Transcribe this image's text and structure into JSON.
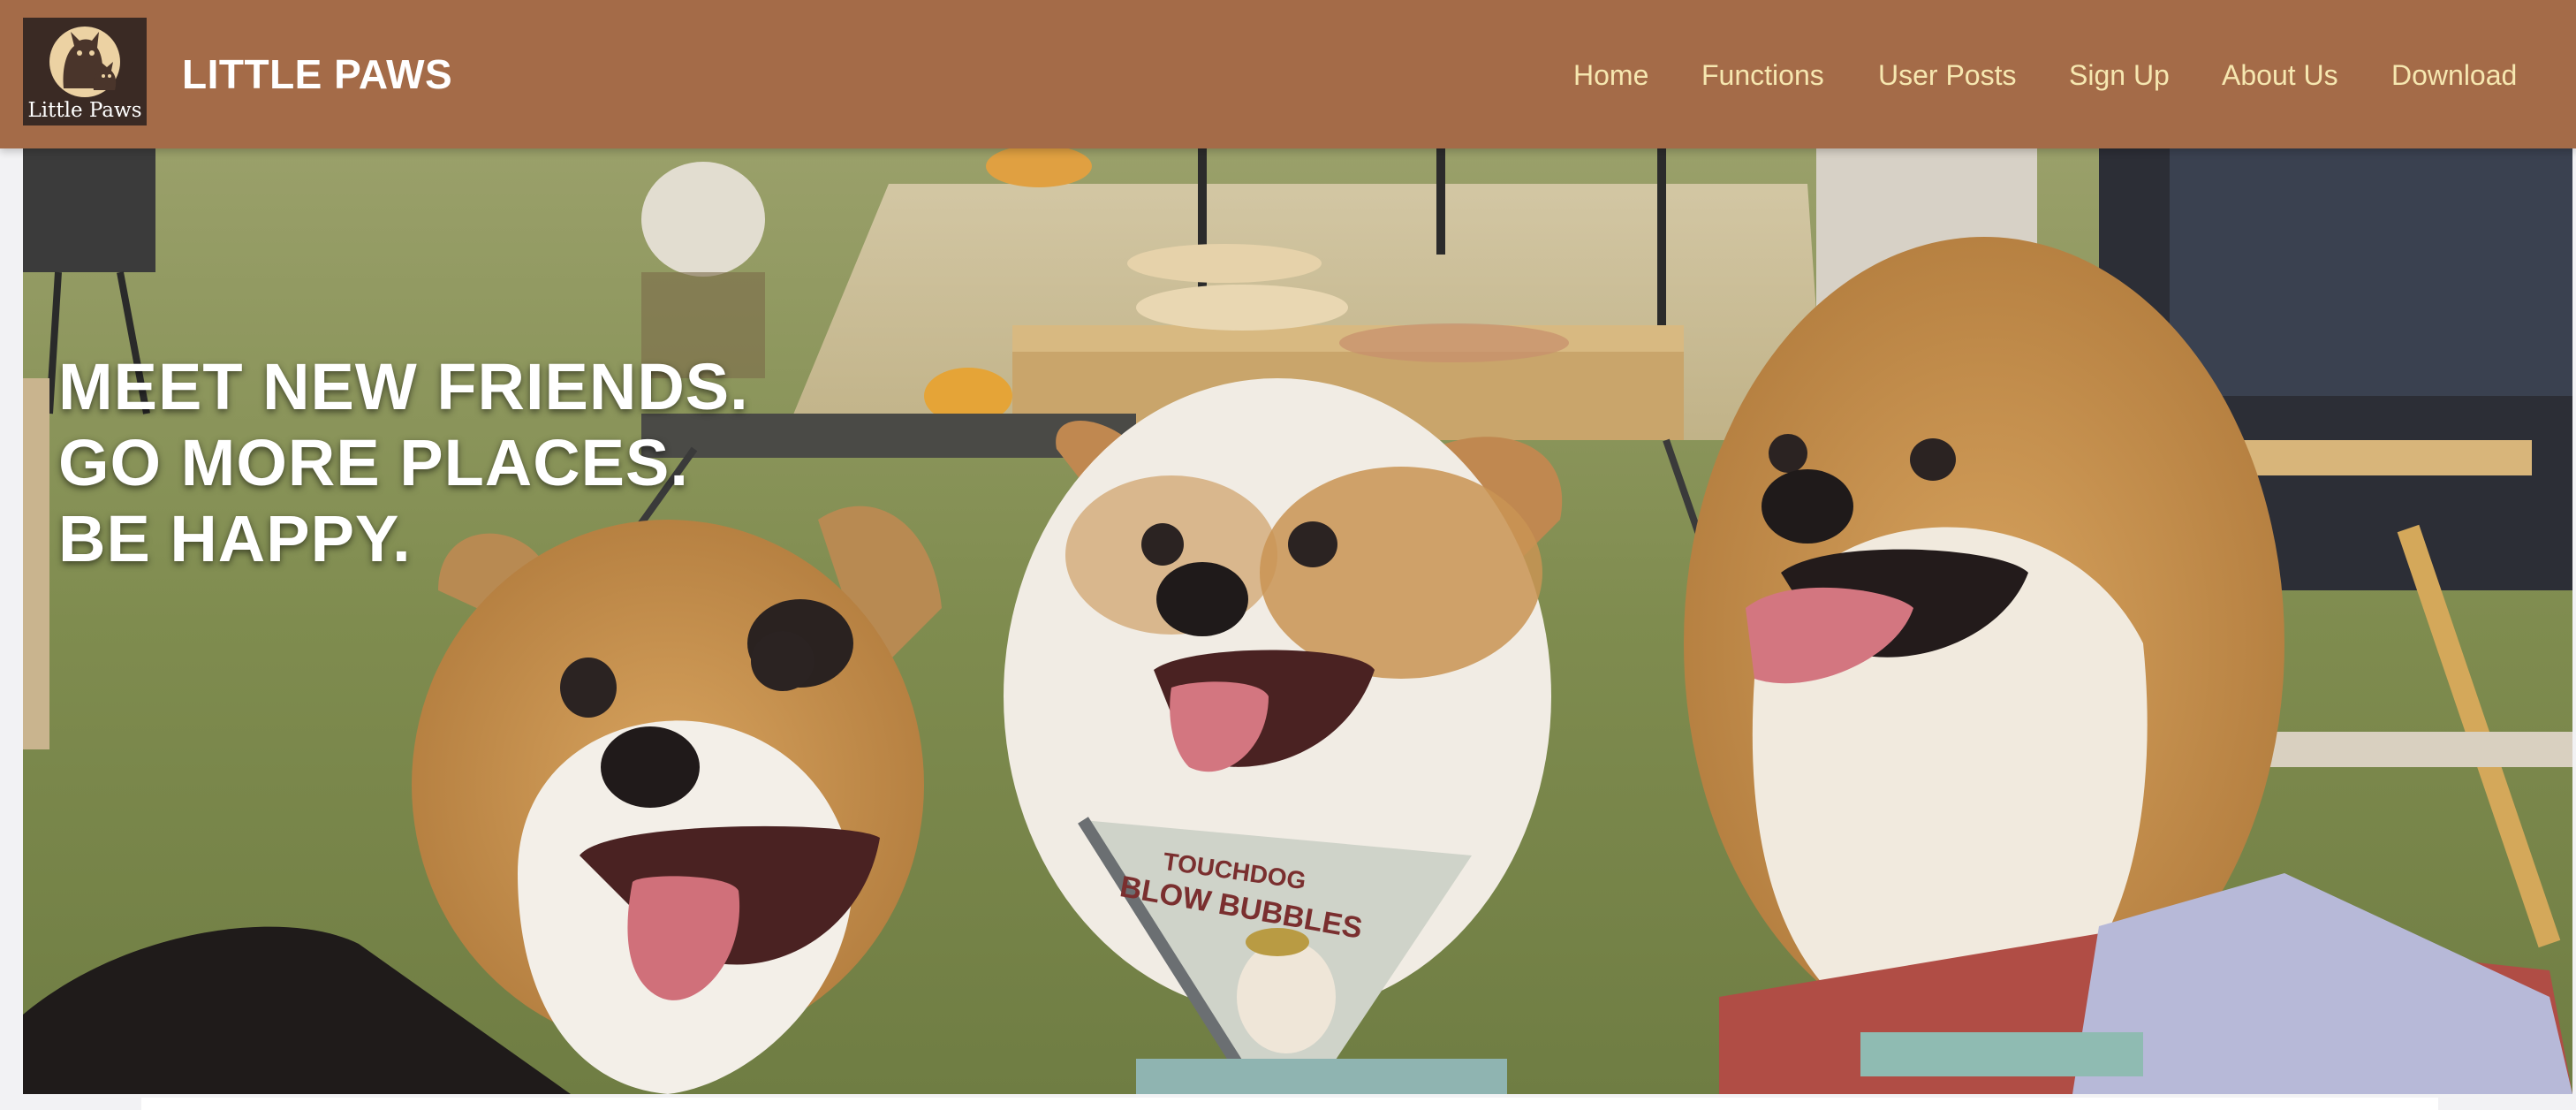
{
  "header": {
    "logo_text": "Little Paws",
    "brand": "LITTLE PAWS",
    "nav": [
      {
        "label": "Home"
      },
      {
        "label": "Functions"
      },
      {
        "label": "User Posts"
      },
      {
        "label": "Sign Up"
      },
      {
        "label": "About Us"
      },
      {
        "label": "Download"
      }
    ]
  },
  "hero": {
    "headline_lines": [
      "MEET NEW FRIENDS.",
      "GO MORE PLACES.",
      "BE HAPPY."
    ],
    "bandana_text_line1": "TOUCHDOG",
    "bandana_text_line2": "BLOW BUBBLES"
  },
  "colors": {
    "header_bg": "#a46b48",
    "nav_text": "#f6e7b0",
    "brand_text": "#ffffff",
    "logo_bg": "#3a2a24"
  }
}
